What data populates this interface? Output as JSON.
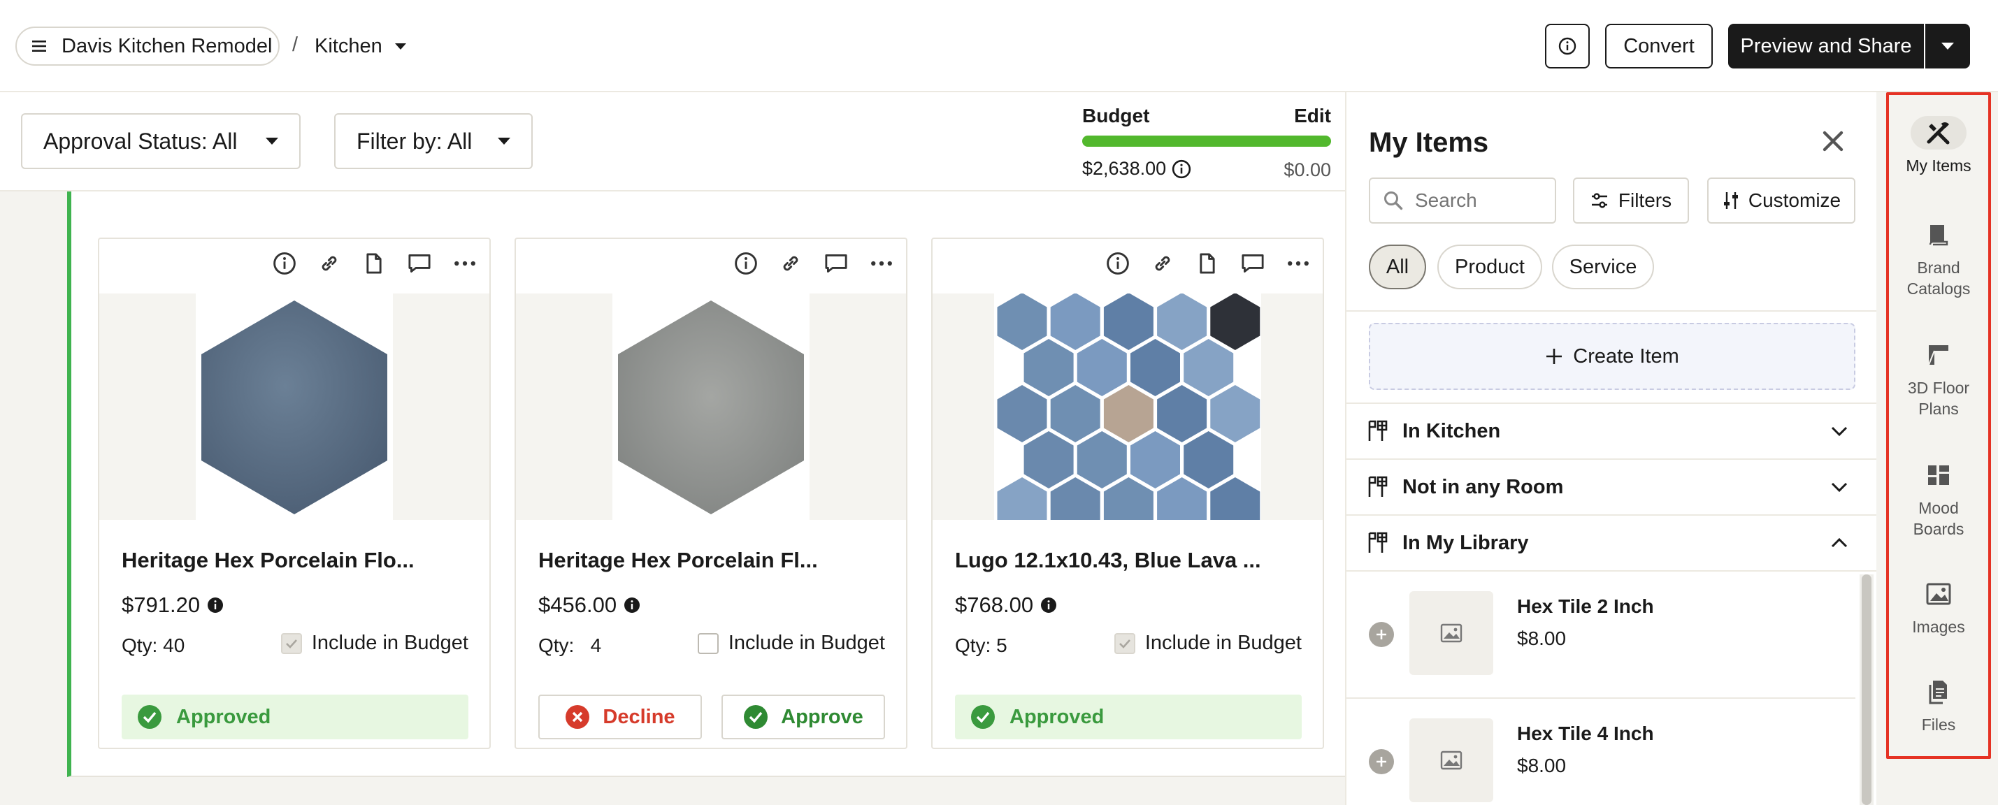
{
  "header": {
    "project_name": "Davis Kitchen Remodel",
    "separator": "/",
    "room": "Kitchen",
    "convert_label": "Convert",
    "preview_label": "Preview and Share"
  },
  "toolbar": {
    "approval_status": "Approval Status: All",
    "filter_by": "Filter by: All"
  },
  "budget": {
    "label": "Budget",
    "edit_label": "Edit",
    "amount": "$2,638.00",
    "remaining": "$0.00",
    "progress": 1.0,
    "bar_color": "#52b82d"
  },
  "cards": [
    {
      "name": "Heritage Hex Porcelain Flo...",
      "price": "$791.20",
      "qty": "Qty: 40",
      "include_label": "Include in Budget",
      "include_checked": true,
      "status": "Approved"
    },
    {
      "name": "Heritage Hex Porcelain Fl...",
      "price": "$456.00",
      "qty": "Qty:   4",
      "include_label": "Include in Budget",
      "include_checked": false,
      "decline_label": "Decline",
      "approve_label": "Approve"
    },
    {
      "name": "Lugo 12.1x10.43, Blue Lava ...",
      "price": "$768.00",
      "qty": "Qty: 5",
      "include_label": "Include in Budget",
      "include_checked": true,
      "status": "Approved"
    }
  ],
  "panel": {
    "title": "My Items",
    "search_placeholder": "Search",
    "filters_label": "Filters",
    "customize_label": "Customize",
    "chips": [
      "All",
      "Product",
      "Service"
    ],
    "active_chip": "All",
    "create_label": "Create Item",
    "sections": [
      {
        "label": "In Kitchen",
        "expanded": false
      },
      {
        "label": "Not in any Room",
        "expanded": false
      },
      {
        "label": "In My Library",
        "expanded": true
      }
    ],
    "library_items": [
      {
        "name": "Hex Tile 2 Inch",
        "price": "$8.00"
      },
      {
        "name": "Hex Tile 4 Inch",
        "price": "$8.00"
      }
    ]
  },
  "rail": {
    "items": [
      {
        "label": "My Items",
        "icon": "tools-icon",
        "active": true
      },
      {
        "label": "Brand Catalogs",
        "icon": "book-icon"
      },
      {
        "label": "3D Floor Plans",
        "icon": "floor-plan-icon"
      },
      {
        "label": "Mood Boards",
        "icon": "mood-board-icon"
      },
      {
        "label": "Images",
        "icon": "image-icon"
      },
      {
        "label": "Files",
        "icon": "files-icon"
      }
    ],
    "highlight_color": "#e53224"
  },
  "colors": {
    "approved_bg": "#e7f7e1",
    "approved_text": "#3a9a3e",
    "decline": "#d63b2b",
    "accent_green": "#3fb34f"
  }
}
